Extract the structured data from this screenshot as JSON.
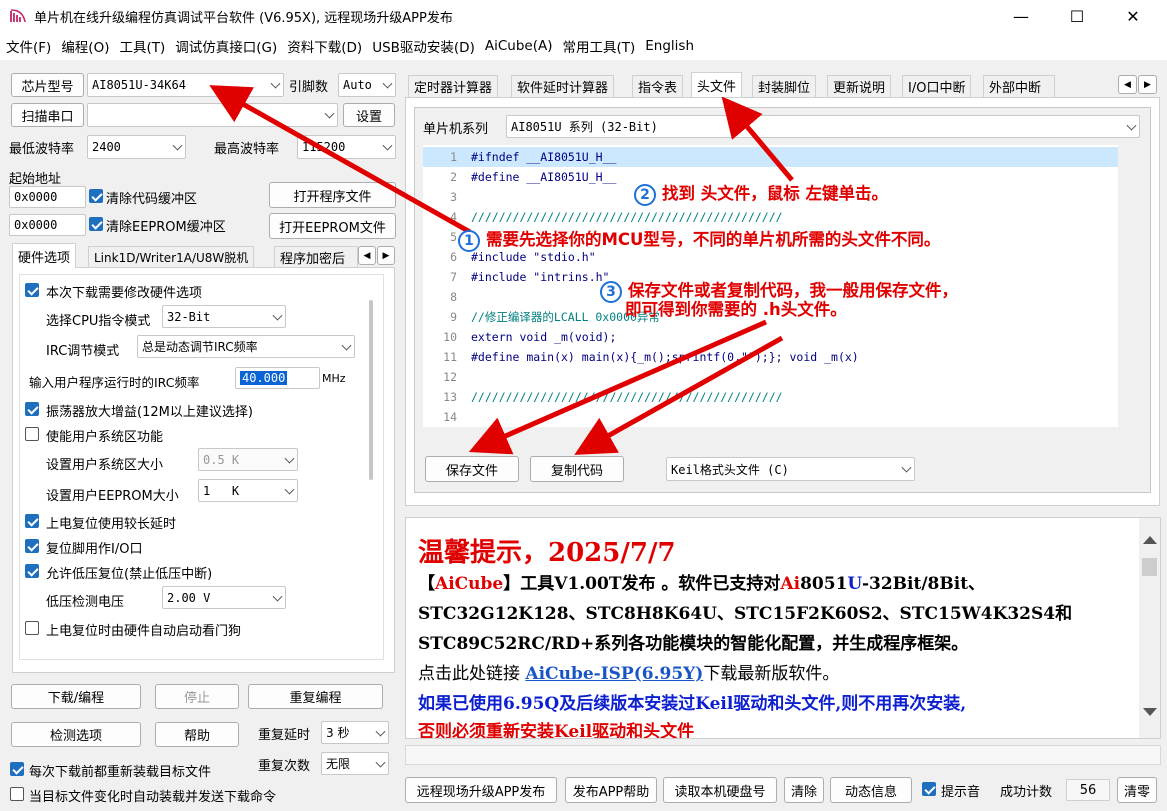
{
  "window": {
    "title": "单片机在线升级编程仿真调试平台软件 (V6.95X), 远程现场升级APP发布",
    "minimize": "—",
    "maximize": "☐",
    "close": "✕"
  },
  "menu": [
    "文件(F)",
    "编程(O)",
    "工具(T)",
    "调试仿真接口(G)",
    "资料下载(D)",
    "USB驱动安装(D)",
    "AiCube(A)",
    "常用工具(T)",
    "English"
  ],
  "left": {
    "chip_label": "芯片型号",
    "chip_value": "AI8051U-34K64",
    "pin_label": "引脚数",
    "pin_value": "Auto",
    "scan_button": "扫描串口",
    "port_value": "",
    "settings_button": "设置",
    "min_baud_label": "最低波特率",
    "min_baud_value": "2400",
    "max_baud_label": "最高波特率",
    "max_baud_value": "115200",
    "start_addr_label": "起始地址",
    "code_addr": "0x0000",
    "clear_code_label": "清除代码缓冲区",
    "open_program_button": "打开程序文件",
    "eeprom_addr": "0x0000",
    "clear_eeprom_label": "清除EEPROM缓冲区",
    "open_eeprom_button": "打开EEPROM文件",
    "tabs": [
      "硬件选项",
      "Link1D/Writer1A/U8W脱机",
      "程序加密后"
    ],
    "hw": {
      "modify_hw": "本次下载需要修改硬件选项",
      "cpu_mode_label": "选择CPU指令模式",
      "cpu_mode_value": "32-Bit",
      "irc_mode_label": "IRC调节模式",
      "irc_mode_value": "总是动态调节IRC频率",
      "irc_freq_label": "输入用户程序运行时的IRC频率",
      "irc_freq_value": "40.000",
      "irc_unit": "MHz",
      "osc_gain": "振荡器放大增益(12M以上建议选择)",
      "user_sys": "使能用户系统区功能",
      "user_sys_size_label": "设置用户系统区大小",
      "user_sys_size_value": "0.5 K",
      "user_eeprom_label": "设置用户EEPROM大小",
      "user_eeprom_value": "1   K",
      "long_delay": "上电复位使用较长延时",
      "reset_io": "复位脚用作I/O口",
      "lvr": "允许低压复位(禁止低压中断)",
      "lvd_label": "低压检测电压",
      "lvd_value": "2.00 V",
      "wdt": "上电复位时由硬件自动启动看门狗"
    },
    "download_button": "下载/编程",
    "stop_button": "停止",
    "repeat_button": "重复编程",
    "check_button": "检测选项",
    "help_button": "帮助",
    "repeat_delay_label": "重复延时",
    "repeat_delay_value": "3 秒",
    "repeat_count_label": "重复次数",
    "repeat_count_value": "无限",
    "reload_label": "每次下载前都重新装载目标文件",
    "auto_send_label": "当目标文件变化时自动装载并发送下载命令"
  },
  "right": {
    "tabs": [
      "定时器计算器",
      "软件延时计算器",
      "指令表",
      "头文件",
      "封装脚位",
      "更新说明",
      "I/O口中断",
      "外部中断"
    ],
    "series_label": "单片机系列",
    "series_value": "AI8051U 系列 (32-Bit)",
    "code": [
      {
        "n": "1",
        "t": "#ifndef __AI8051U_H__"
      },
      {
        "n": "2",
        "t": "#define __AI8051U_H__"
      },
      {
        "n": "3",
        "t": ""
      },
      {
        "n": "4",
        "t": "/////////////////////////////////////////////"
      },
      {
        "n": "5",
        "t": ""
      },
      {
        "n": "6",
        "t": "#include \"stdio.h\""
      },
      {
        "n": "7",
        "t": "#include \"intrins.h\""
      },
      {
        "n": "8",
        "t": ""
      },
      {
        "n": "9",
        "t": "//修正编译器的LCALL 0x0000异常"
      },
      {
        "n": "10",
        "t": "extern void _m(void);"
      },
      {
        "n": "11",
        "t": "#define main(x) main(x){_m();sprintf(0,\"\");}; void _m(x)"
      },
      {
        "n": "12",
        "t": ""
      },
      {
        "n": "13",
        "t": "/////////////////////////////////////////////"
      },
      {
        "n": "14",
        "t": ""
      }
    ],
    "save_button": "保存文件",
    "copy_button": "复制代码",
    "format_value": "Keil格式头文件 (C)"
  },
  "notice": {
    "title": "温馨提示，2025/7/7",
    "l1_a": "【",
    "l1_b": "AiCube",
    "l1_c": "】工具V1.00T发布 。软件已支持对",
    "l1_d": "Ai",
    "l1_e": "8051",
    "l1_f": "U",
    "l1_g": "-32Bit/8Bit、",
    "l2": "STC32G12K128、STC8H8K64U、STC15F2K60S2、STC15W4K32S4和",
    "l3": "STC89C52RC/RD+系列各功能模块的智能化配置，并生成程序框架。",
    "l4_a": "点击此处链接",
    "l4_link": "AiCube-ISP(6.95Y)",
    "l4_b": "下载最新版软件。",
    "l5": "如果已使用6.95Q及后续版本安装过Keil驱动和头文件,则不用再次安装,",
    "l6": "否则必须重新安装Keil驱动和头文件"
  },
  "bottom": {
    "remote_button": "远程现场升级APP发布",
    "app_help_button": "发布APP帮助",
    "disk_button": "读取本机硬盘号",
    "clear_button": "清除",
    "dynamic_button": "动态信息",
    "beep_label": "提示音",
    "success_label": "成功计数",
    "success_count": "56",
    "reset_button": "清零"
  },
  "annotations": {
    "a1_num": "1",
    "a1": "需要先选择你的MCU型号，不同的单片机所需的头文件不同。",
    "a2_num": "2",
    "a2": "找到 头文件，鼠标 左键单击。",
    "a3_num": "3",
    "a3_l1": "保存文件或者复制代码，我一般用保存文件，",
    "a3_l2": "即可得到你需要的 .h头文件。"
  },
  "colors": {
    "accent": "#1f6fbf",
    "annotation": "#e00000",
    "notice_blue": "#0b1fd0",
    "link": "#1a55c8"
  }
}
